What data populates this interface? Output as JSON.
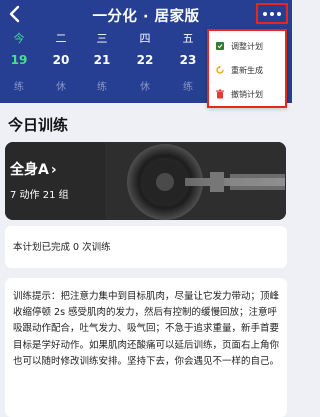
{
  "header": {
    "title": "一分化 · 居家版",
    "back_icon": "chevron-left-icon",
    "more_icon": "more-horizontal-icon",
    "background": "#263f93"
  },
  "week": [
    {
      "weekday": "今",
      "date": "19",
      "status": "练",
      "today": true
    },
    {
      "weekday": "二",
      "date": "20",
      "status": "休",
      "today": false
    },
    {
      "weekday": "三",
      "date": "21",
      "status": "练",
      "today": false
    },
    {
      "weekday": "四",
      "date": "22",
      "status": "休",
      "today": false
    },
    {
      "weekday": "五",
      "date": "23",
      "status": "练",
      "today": false
    }
  ],
  "menu": {
    "items": [
      {
        "label": "调整计划",
        "icon": "adjust-plan-icon",
        "color": "#2e7d32"
      },
      {
        "label": "重新生成",
        "icon": "regenerate-icon",
        "color": "#f5a623"
      },
      {
        "label": "撤销计划",
        "icon": "delete-plan-icon",
        "color": "#e53935"
      }
    ]
  },
  "section": {
    "title": "今日训练"
  },
  "workout": {
    "name": "全身A",
    "arrow": "›",
    "summary": "7 动作 21 组"
  },
  "completed_text": "本计划已完成 0 次训练",
  "tips": "训练提示：把注意力集中到目标肌肉，尽量让它发力带动；顶峰收缩停顿 2s 感受肌肉的发力，然后有控制的缓慢回放；注意呼吸跟动作配合，吐气发力、吸气回；不急于追求重量，新手首要目标是学好动作。如果肌肉还酸痛可以延后训练，页面右上角你也可以随时修改训练安排。坚持下去，你会遇见不一样的自己。",
  "colors": {
    "accent_green": "#46e08e",
    "highlight_red": "#e8261e"
  }
}
